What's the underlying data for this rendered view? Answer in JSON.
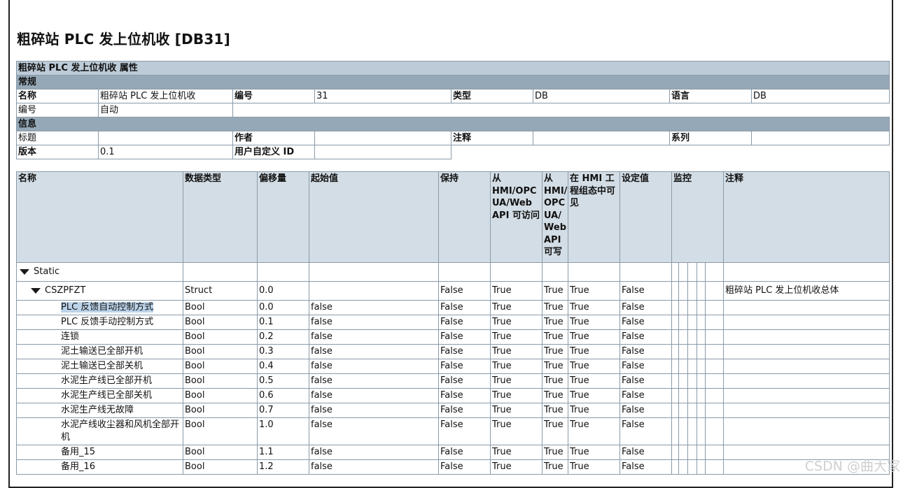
{
  "title": "粗碎站 PLC 发上位机收 [DB31]",
  "props": {
    "header": "粗碎站 PLC 发上位机收 属性",
    "section_general": "常规",
    "name_label": "名称",
    "name_value": "粗碎站 PLC 发上位机收",
    "number_label": "编号",
    "number_value": "31",
    "type_label": "类型",
    "type_value": "DB",
    "lang_label": "语言",
    "lang_value": "DB",
    "numbering_label": "编号",
    "numbering_value": "自动",
    "section_info": "信息",
    "title_label": "标题",
    "title_value": "",
    "author_label": "作者",
    "author_value": "",
    "comment_label": "注释",
    "comment_value": "",
    "family_label": "系列",
    "family_value": "",
    "version_label": "版本",
    "version_value": "0.1",
    "userid_label": "用户自定义 ID",
    "userid_value": ""
  },
  "columns": [
    "名称",
    "数据类型",
    "偏移量",
    "起始值",
    "保持",
    "从 HMI/OPC UA/Web API 可访问",
    "从 HMI/ OPC UA/ Web API 可写",
    "在 HMI 工程组态中可见",
    "设定值",
    "监控",
    "注释"
  ],
  "rows": [
    {
      "name": "Static",
      "level": 0,
      "expand": true,
      "type": "",
      "offset": "",
      "start": "",
      "retain": "",
      "access": "",
      "write": "",
      "visible": "",
      "setpoint": "",
      "comment": ""
    },
    {
      "name": "CSZPFZT",
      "level": 1,
      "expand": true,
      "type": "Struct",
      "offset": "0.0",
      "start": "",
      "retain": "False",
      "access": "True",
      "write": "True",
      "visible": "True",
      "setpoint": "False",
      "comment": "粗碎站 PLC 发上位机收总体"
    },
    {
      "name": "PLC 反馈自动控制方式",
      "level": 2,
      "highlight": true,
      "type": "Bool",
      "offset": "0.0",
      "start": "false",
      "retain": "False",
      "access": "True",
      "write": "True",
      "visible": "True",
      "setpoint": "False",
      "comment": ""
    },
    {
      "name": "PLC 反馈手动控制方式",
      "level": 2,
      "type": "Bool",
      "offset": "0.1",
      "start": "false",
      "retain": "False",
      "access": "True",
      "write": "True",
      "visible": "True",
      "setpoint": "False",
      "comment": ""
    },
    {
      "name": "连锁",
      "level": 2,
      "type": "Bool",
      "offset": "0.2",
      "start": "false",
      "retain": "False",
      "access": "True",
      "write": "True",
      "visible": "True",
      "setpoint": "False",
      "comment": ""
    },
    {
      "name": "泥土输送已全部开机",
      "level": 2,
      "type": "Bool",
      "offset": "0.3",
      "start": "false",
      "retain": "False",
      "access": "True",
      "write": "True",
      "visible": "True",
      "setpoint": "False",
      "comment": ""
    },
    {
      "name": "泥土输送已全部关机",
      "level": 2,
      "type": "Bool",
      "offset": "0.4",
      "start": "false",
      "retain": "False",
      "access": "True",
      "write": "True",
      "visible": "True",
      "setpoint": "False",
      "comment": ""
    },
    {
      "name": "水泥生产线已全部开机",
      "level": 2,
      "type": "Bool",
      "offset": "0.5",
      "start": "false",
      "retain": "False",
      "access": "True",
      "write": "True",
      "visible": "True",
      "setpoint": "False",
      "comment": ""
    },
    {
      "name": "水泥生产线已全部关机",
      "level": 2,
      "type": "Bool",
      "offset": "0.6",
      "start": "false",
      "retain": "False",
      "access": "True",
      "write": "True",
      "visible": "True",
      "setpoint": "False",
      "comment": ""
    },
    {
      "name": "水泥生产线无故障",
      "level": 2,
      "type": "Bool",
      "offset": "0.7",
      "start": "false",
      "retain": "False",
      "access": "True",
      "write": "True",
      "visible": "True",
      "setpoint": "False",
      "comment": ""
    },
    {
      "name": "水泥产线收尘器和风机全部开机",
      "level": 2,
      "type": "Bool",
      "offset": "1.0",
      "start": "false",
      "retain": "False",
      "access": "True",
      "write": "True",
      "visible": "True",
      "setpoint": "False",
      "comment": ""
    },
    {
      "name": "备用_15",
      "level": 2,
      "type": "Bool",
      "offset": "1.1",
      "start": "false",
      "retain": "False",
      "access": "True",
      "write": "True",
      "visible": "True",
      "setpoint": "False",
      "comment": ""
    },
    {
      "name": "备用_16",
      "level": 2,
      "type": "Bool",
      "offset": "1.2",
      "start": "false",
      "retain": "False",
      "access": "True",
      "write": "True",
      "visible": "True",
      "setpoint": "False",
      "comment": ""
    }
  ],
  "watermark": "CSDN @曲大家"
}
